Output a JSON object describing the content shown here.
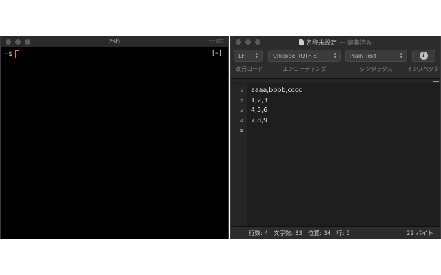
{
  "terminal": {
    "title": "zsh",
    "shortcut": "⌥⌘2",
    "prompt": "~$",
    "mode_indicator": "[~]"
  },
  "editor": {
    "doc_title": "名称未設定",
    "title_dash": "—",
    "doc_status": "編集済み",
    "toolbar": {
      "line_ending": {
        "value": "LF",
        "label": "改行コード"
      },
      "encoding": {
        "value": "Unicode（UTF-8）",
        "label": "エンコーディング"
      },
      "syntax": {
        "value": "Plain Text",
        "label": "シンタックス"
      },
      "inspector": {
        "label": "インスペクタ"
      }
    },
    "line_numbers": [
      "1",
      "2",
      "3",
      "4",
      "5"
    ],
    "lines": [
      "aaaa,bbbb,cccc",
      "1,2,3",
      "4,5,6",
      "7,8,9",
      ""
    ],
    "status": {
      "lines": "行数: 4",
      "chars": "文字数: 33",
      "position": "位置: 34",
      "row": "行: 5",
      "size": "22 バイト"
    }
  },
  "colors": {
    "cursor": "#e8762c",
    "terminal_bg": "#000000",
    "editor_bg": "#1e1e1e"
  }
}
